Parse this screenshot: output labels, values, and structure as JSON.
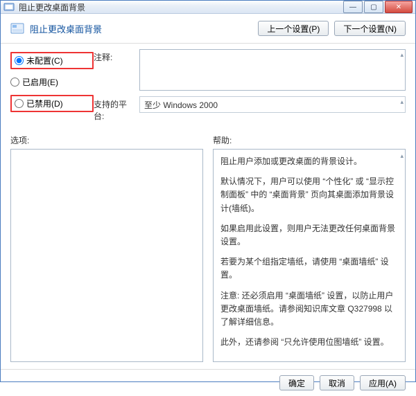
{
  "window": {
    "title": "阻止更改桌面背景",
    "min_glyph": "—",
    "max_glyph": "▢",
    "close_glyph": "✕"
  },
  "header": {
    "title": "阻止更改桌面背景",
    "prev_label": "上一个设置(P)",
    "next_label": "下一个设置(N)"
  },
  "radios": {
    "not_configured": "未配置(C)",
    "enabled": "已启用(E)",
    "disabled": "已禁用(D)",
    "selected": "not_configured"
  },
  "fields": {
    "note_label": "注释:",
    "platform_label": "支持的平台:",
    "platform_value": "至少 Windows 2000"
  },
  "panes": {
    "options_label": "选项:",
    "help_label": "帮助:"
  },
  "help": {
    "p1": "阻止用户添加或更改桌面的背景设计。",
    "p2": "默认情况下，用户可以使用 “个性化” 或 “显示控制面板” 中的 “桌面背景” 页向其桌面添加背景设计(墙纸)。",
    "p3": "如果启用此设置，则用户无法更改任何桌面背景设置。",
    "p4": "若要为某个组指定墙纸，请使用 “桌面墙纸” 设置。",
    "p5": "注意: 还必须启用 “桌面墙纸” 设置，以防止用户更改桌面墙纸。请参阅知识库文章 Q327998 以了解详细信息。",
    "p6": "此外，还请参阅 “只允许使用位图墙纸” 设置。"
  },
  "footer": {
    "ok": "确定",
    "cancel": "取消",
    "apply": "应用(A)"
  },
  "glyphs": {
    "updown": "▴"
  }
}
